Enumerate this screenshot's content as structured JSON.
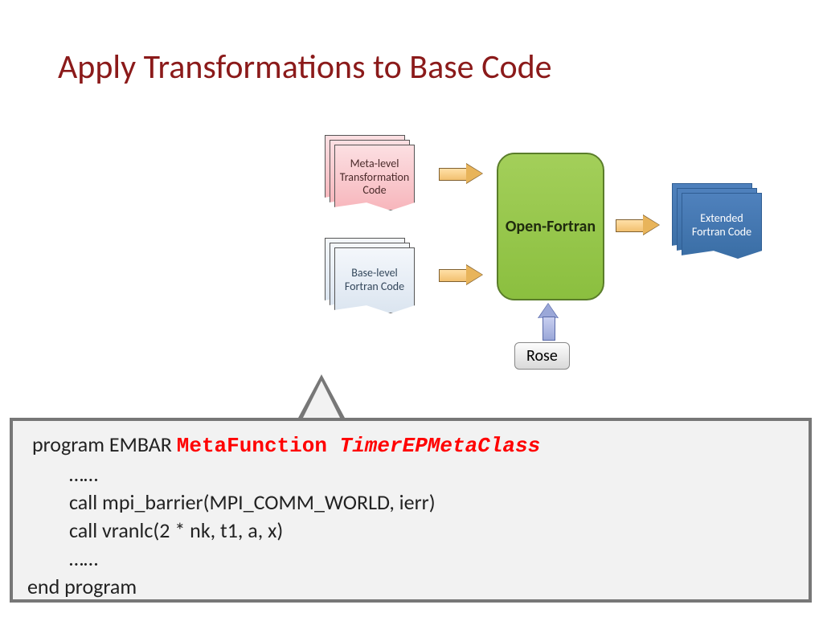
{
  "title": "Apply Transformations to Base Code",
  "nodes": {
    "meta": "Meta-level Transformation Code",
    "base": "Base-level Fortran Code",
    "open": "Open-Fortran",
    "rose": "Rose",
    "ext": "Extended Fortran Code"
  },
  "code": {
    "l1a": "program EMBAR ",
    "l1b": "MetaFunction ",
    "l1c": "TimerEPMetaClass",
    "l2": "……",
    "l3": "call mpi_barrier(MPI_COMM_WORLD, ierr)",
    "l4": "call vranlc(2 * nk, t1, a, x)",
    "l5": "……",
    "l6": "end program"
  }
}
